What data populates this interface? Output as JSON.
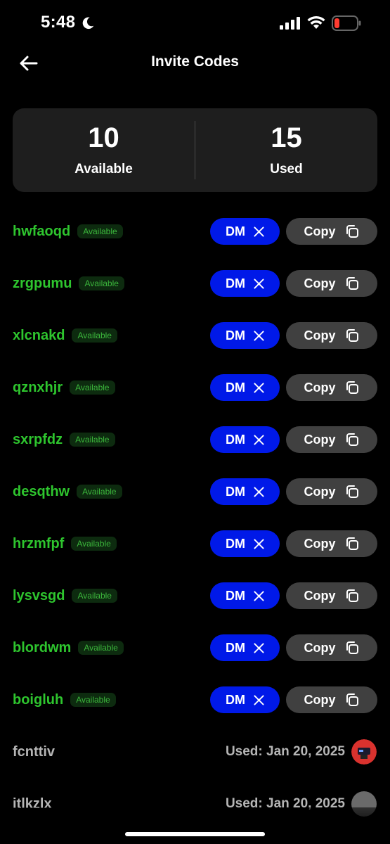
{
  "status_bar": {
    "time": "5:48",
    "icons": [
      "moon-icon",
      "signal-icon",
      "wifi-icon",
      "battery-icon"
    ],
    "battery_color": "#ff3b30"
  },
  "header": {
    "title": "Invite Codes",
    "back_icon": "arrow-left-icon"
  },
  "stats": {
    "available_value": "10",
    "available_label": "Available",
    "used_value": "15",
    "used_label": "Used"
  },
  "codes": [
    {
      "code": "hwfaoqd",
      "status": "Available",
      "dm_label": "DM",
      "copy_label": "Copy"
    },
    {
      "code": "zrgpumu",
      "status": "Available",
      "dm_label": "DM",
      "copy_label": "Copy"
    },
    {
      "code": "xlcnakd",
      "status": "Available",
      "dm_label": "DM",
      "copy_label": "Copy"
    },
    {
      "code": "qznxhjr",
      "status": "Available",
      "dm_label": "DM",
      "copy_label": "Copy"
    },
    {
      "code": "sxrpfdz",
      "status": "Available",
      "dm_label": "DM",
      "copy_label": "Copy"
    },
    {
      "code": "desqthw",
      "status": "Available",
      "dm_label": "DM",
      "copy_label": "Copy"
    },
    {
      "code": "hrzmfpf",
      "status": "Available",
      "dm_label": "DM",
      "copy_label": "Copy"
    },
    {
      "code": "lysvsgd",
      "status": "Available",
      "dm_label": "DM",
      "copy_label": "Copy"
    },
    {
      "code": "blordwm",
      "status": "Available",
      "dm_label": "DM",
      "copy_label": "Copy"
    },
    {
      "code": "boigluh",
      "status": "Available",
      "dm_label": "DM",
      "copy_label": "Copy"
    }
  ],
  "used_codes": [
    {
      "code": "fcnttiv",
      "used_text": "Used: Jan 20, 2025"
    },
    {
      "code": "itlkzlx",
      "used_text": "Used: Jan 20, 2025"
    }
  ],
  "colors": {
    "accent_green": "#2ec52e",
    "dm_blue": "#0019e8",
    "copy_gray": "#404040",
    "card_bg": "#1e1e1e"
  }
}
